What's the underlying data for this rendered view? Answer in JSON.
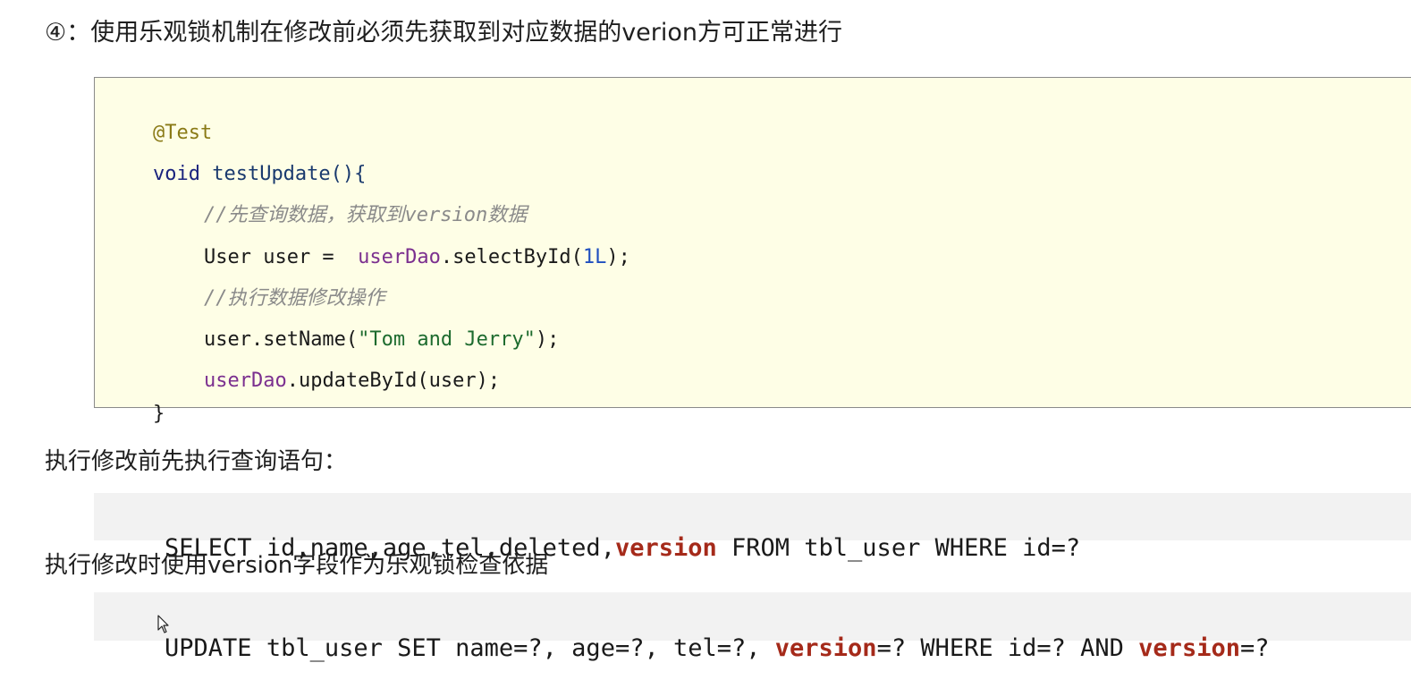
{
  "heading": {
    "text": "④：使用乐观锁机制在修改前必须先获取到对应数据的verion方可正常进行"
  },
  "code": {
    "annotation": "@Test",
    "void_kw": "void",
    "method_sig": " testUpdate(){",
    "comment1": "//先查询数据，获取到version数据",
    "line4_prefix": "User user =  ",
    "line4_field": "userDao",
    "line4_mid": ".selectById(",
    "line4_num": "1L",
    "line4_suffix": ");",
    "comment2": "//执行数据修改操作",
    "line6_prefix": "user.setName(",
    "line6_str": "\"Tom and Jerry\"",
    "line6_suffix": ");",
    "line7_field": "userDao",
    "line7_rest": ".updateById(user);",
    "closing": "}"
  },
  "label_select": "执行修改前先执行查询语句：",
  "sql_select": {
    "part1": "SELECT id,name,age,tel,deleted,",
    "kw": "version",
    "part2": " FROM tbl_user WHERE id=?"
  },
  "label_update": "执行修改时使用version字段作为乐观锁检查依据",
  "sql_update": {
    "part1": "UPDATE tbl_user SET name=?, age=?, tel=?, ",
    "kw1": "version",
    "part2": "=? WHERE id=? AND ",
    "kw2": "version",
    "part3": "=?"
  }
}
